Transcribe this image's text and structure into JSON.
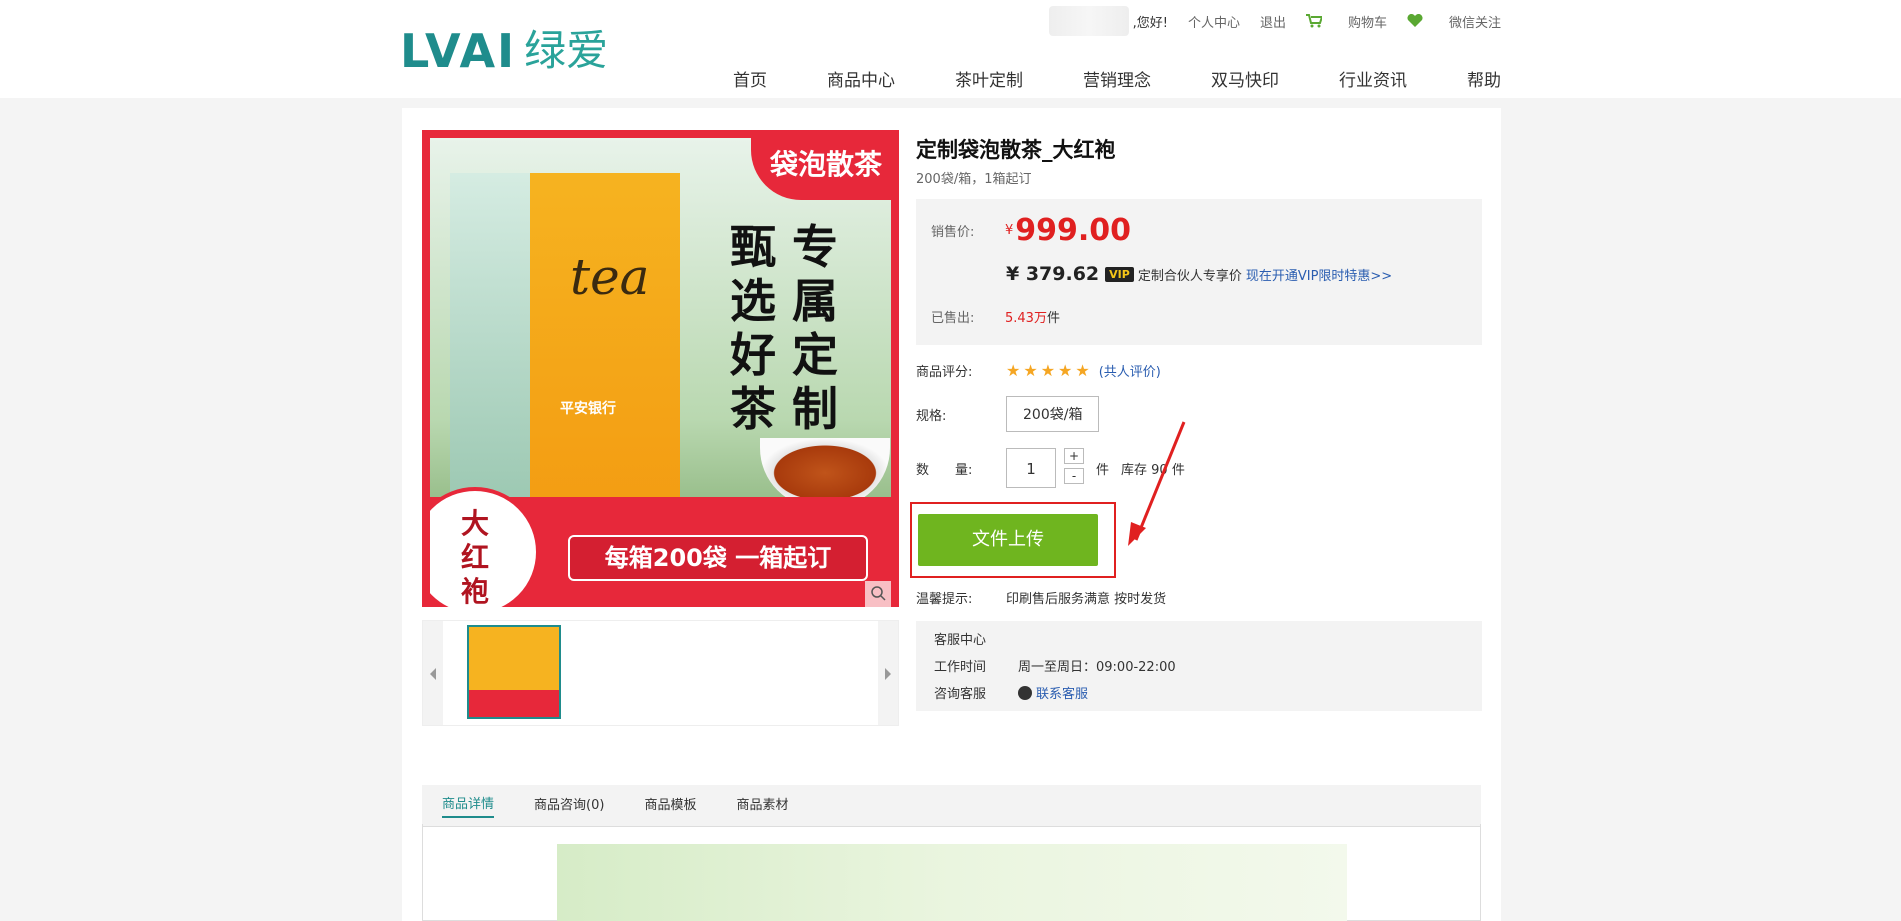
{
  "brand": {
    "logo_mark": "LVAI",
    "logo_cn": "绿爱"
  },
  "topbar": {
    "greeting": ",您好!",
    "user_center": "个人中心",
    "logout": "退出",
    "cart": "购物车",
    "wechat": "微信关注"
  },
  "nav": [
    "首页",
    "商品中心",
    "茶叶定制",
    "营销理念",
    "双马快印",
    "行业资讯",
    "帮助"
  ],
  "product_image": {
    "badge": "袋泡散茶",
    "slogan": [
      "甄",
      "选",
      "好",
      "茶",
      "专",
      "属",
      "定",
      "制"
    ],
    "bag_text": "tea",
    "bank_text": "平安银行",
    "bottom_text": "每箱200袋 一箱起订",
    "stamp": "大红袍"
  },
  "product": {
    "title": "定制袋泡散茶_大红袍",
    "subtitle": "200袋/箱，1箱起订",
    "price_label": "销售价:",
    "price_currency": "¥",
    "price": "999.00",
    "vip_price": "¥ 379.62",
    "vip_badge": "VIP",
    "vip_text": "定制合伙人专享价",
    "vip_link": "现在开通VIP限时特惠>>",
    "sold_label": "已售出:",
    "sold_value": "5.43万",
    "sold_unit": "件",
    "rating_label": "商品评分:",
    "stars": "★★★★★",
    "reviews": "(共人评价)",
    "spec_label": "规格:",
    "spec_value": "200袋/箱",
    "qty_label": "数　　量:",
    "qty_value": "1",
    "qty_plus": "+",
    "qty_minus": "-",
    "qty_unit": "件",
    "stock_text": "库存 90 件",
    "upload_button": "文件上传",
    "tip_label": "温馨提示:",
    "tip_text": "印刷售后服务满意 按时发货"
  },
  "service": {
    "title": "客服中心",
    "hours_label": "工作时间",
    "hours_value": "周一至周日：09:00-22:00",
    "contact_label": "咨询客服",
    "contact_link": "联系客服"
  },
  "tabs": [
    "商品详情",
    "商品咨询(0)",
    "商品模板",
    "商品素材"
  ],
  "colors": {
    "accent": "#1f8c8c",
    "price": "#e02020",
    "upload": "#6fb51f",
    "banner_red": "#e7283a"
  }
}
